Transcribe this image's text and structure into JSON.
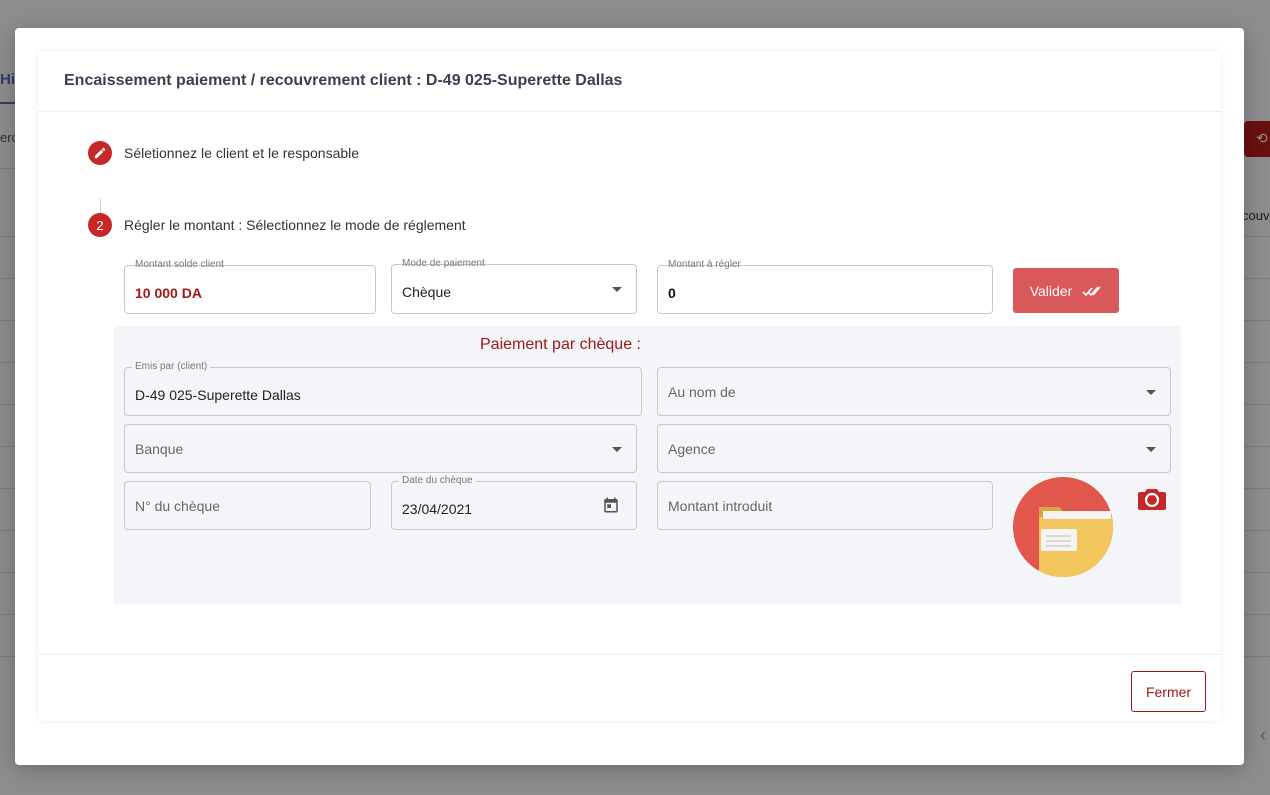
{
  "background": {
    "tab_fragment": "Hi",
    "left_fragment": "erc",
    "right_fragment": "couv",
    "right_button_icon": "refresh-icon"
  },
  "modal": {
    "title": "Encaissement paiement / recouvrement client : D-49 025-Superette Dallas",
    "steps": [
      {
        "marker_icon": "pencil-icon",
        "label": "Séletionnez le client et le responsable"
      },
      {
        "number": "2",
        "label": "Régler le montant : Sélectionnez le mode de réglement"
      }
    ],
    "payment_row": {
      "solde": {
        "label": "Montant solde client",
        "value": "10 000 DA"
      },
      "mode": {
        "label": "Mode de paiement",
        "value": "Chèque"
      },
      "montant": {
        "label": "Montant à régler",
        "value": "0"
      },
      "valider_label": "Valider"
    },
    "cheque": {
      "title": "Paiement par chèque :",
      "emis_par": {
        "label": "Emis par (client)",
        "value": "D-49 025-Superette Dallas"
      },
      "au_nom_de": {
        "placeholder": "Au nom de"
      },
      "banque": {
        "placeholder": "Banque"
      },
      "agence": {
        "placeholder": "Agence"
      },
      "numero": {
        "placeholder": "N° du chèque"
      },
      "date": {
        "label": "Date du chèque",
        "value": "23/04/2021"
      },
      "montant_introduit": {
        "placeholder": "Montant introduit"
      }
    },
    "footer": {
      "close_label": "Fermer"
    }
  },
  "colors": {
    "accent_red": "#c62828",
    "dark_red": "#a01818",
    "valider_bg": "#d9585a",
    "panel_bg": "#f4f5f8"
  }
}
